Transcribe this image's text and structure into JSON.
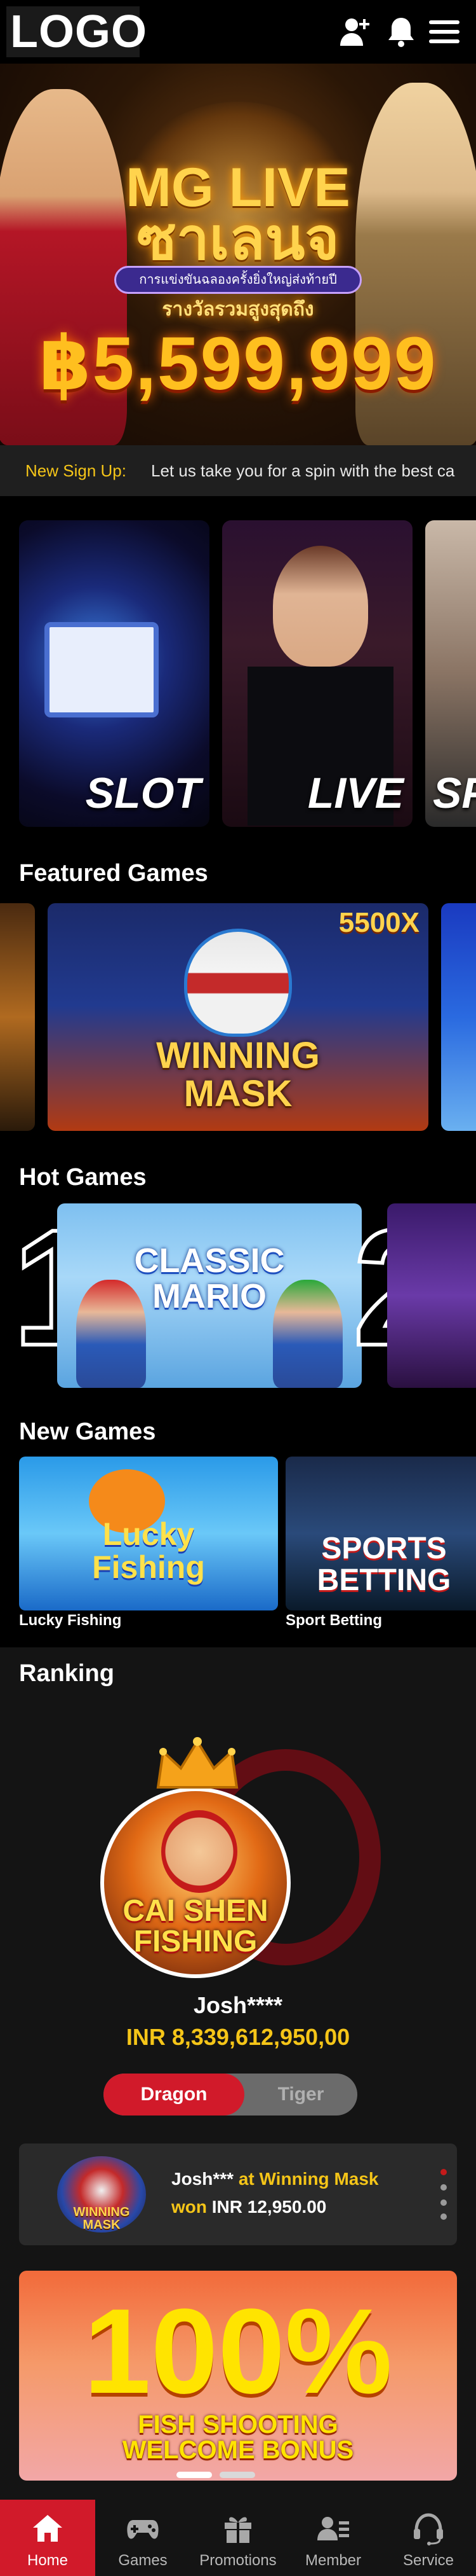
{
  "header": {
    "logo_text": "LOGO"
  },
  "banner": {
    "title_line1": "MG LIVE",
    "title_line2": "ซาเลนจ",
    "subtitle": "การแข่งขันฉลองครั้งยิ่งใหญ่ส่งท้ายปี",
    "prize_label": "รางวัลรวมสูงสุดถึง",
    "amount": "฿5,599,999"
  },
  "marquee": {
    "label": "New Sign Up:",
    "text": "Let us take you for a spin with the best ca"
  },
  "categories": [
    {
      "name": "SLOT"
    },
    {
      "name": "LIVE"
    },
    {
      "name": "SP"
    }
  ],
  "featured": {
    "title": "Featured Games",
    "main": {
      "multiplier": "5500X",
      "line1": "WINNING",
      "line2": "MASK"
    }
  },
  "hot": {
    "title": "Hot Games",
    "ranks": [
      "1",
      "2"
    ],
    "game1": {
      "line1": "CLASSIC",
      "line2": "MARIO"
    }
  },
  "new_games": {
    "title": "New Games",
    "items": [
      {
        "label": "Lucky Fishing",
        "art_line1": "Lucky",
        "art_line2": "Fishing"
      },
      {
        "label": "Sport Betting",
        "art_line1": "SPORTS",
        "art_line2": "BETTING"
      }
    ]
  },
  "ranking": {
    "title": "Ranking",
    "avatar_game_line1": "CAI SHEN",
    "avatar_game_line2": "FISHING",
    "winner_name": "Josh****",
    "winner_amount": "INR 8,339,612,950,00",
    "toggle": {
      "active": "Dragon",
      "inactive": "Tiger"
    },
    "recent": {
      "thumb_text": "WINNING MASK",
      "user": "Josh***",
      "at": "at Winning Mask",
      "won_label": "won",
      "amount": "INR 12,950.00"
    },
    "promo": {
      "big": "100%",
      "line1": "FISH SHOOTING",
      "line2": "WELCOME BONUS"
    }
  },
  "nav": [
    {
      "label": "Home",
      "icon": "home-icon",
      "active": true
    },
    {
      "label": "Games",
      "icon": "gamepad-icon",
      "active": false
    },
    {
      "label": "Promotions",
      "icon": "gift-icon",
      "active": false
    },
    {
      "label": "Member",
      "icon": "member-card-icon",
      "active": false
    },
    {
      "label": "Service",
      "icon": "headset-icon",
      "active": false
    }
  ],
  "colors": {
    "accent": "#d11a2a",
    "gold": "#f5c518",
    "bg": "#000000",
    "panel": "#141414"
  }
}
